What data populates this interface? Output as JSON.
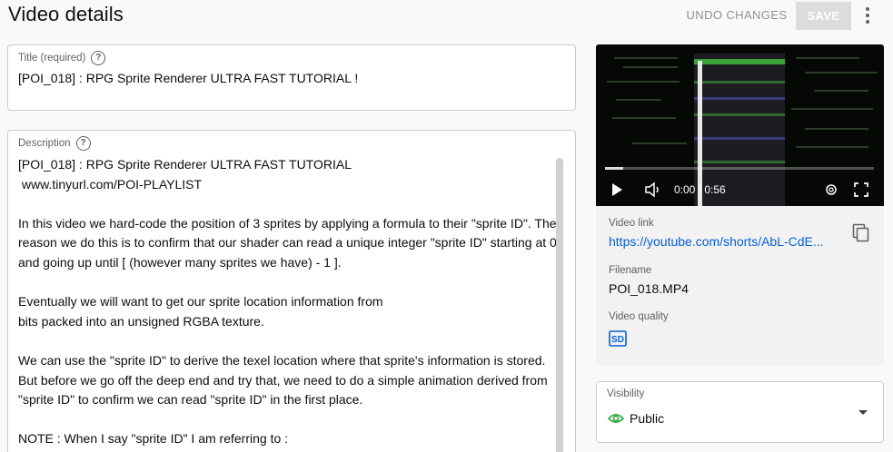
{
  "header": {
    "title": "Video details",
    "undo_label": "UNDO CHANGES",
    "save_label": "SAVE"
  },
  "title_field": {
    "label": "Title (required)",
    "value": "[POI_018] : RPG Sprite Renderer ULTRA FAST TUTORIAL !"
  },
  "description_field": {
    "label": "Description",
    "lines": [
      "[POI_018] : RPG Sprite Renderer ULTRA FAST TUTORIAL",
      " www.tinyurl.com/POI-PLAYLIST",
      "",
      "In this video we hard-code the position of 3 sprites by applying a formula to their \"sprite ID\". The",
      "reason we do this is to confirm that our shader can read a unique integer \"sprite ID\" starting at 0",
      "and going up until [ (however many sprites we have) - 1 ].",
      "",
      "Eventually we will want to get our sprite location information from",
      "bits packed into an unsigned RGBA texture.",
      "",
      "We can use the \"sprite ID\" to derive the texel location where that sprite's information is stored.",
      "But before we go off the deep end and try that, we need to do a simple animation derived from",
      "\"sprite ID\" to confirm we can read \"sprite ID\" in the first place.",
      "",
      "NOTE : When I say \"sprite ID\" I am referring to :"
    ]
  },
  "player": {
    "time": "0:00 / 0:56",
    "progress": 0.0
  },
  "side": {
    "video_link_label": "Video link",
    "video_link": "https://youtube.com/shorts/AbL-CdE...",
    "filename_label": "Filename",
    "filename": "POI_018.MP4",
    "quality_label": "Video quality",
    "quality_badge": "SD"
  },
  "visibility": {
    "label": "Visibility",
    "value": "Public"
  },
  "colors": {
    "link": "#065fd4",
    "visibility_icon": "#2ba640",
    "quality_badge": "#065fd4"
  }
}
